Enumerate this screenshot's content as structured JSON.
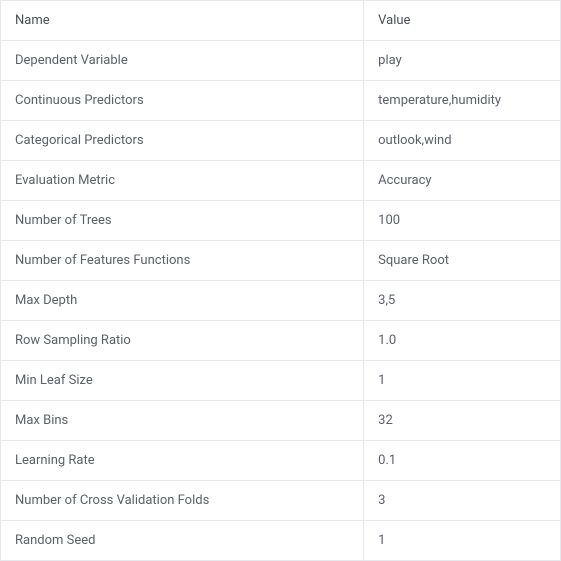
{
  "table": {
    "headers": {
      "name": "Name",
      "value": "Value"
    },
    "rows": [
      {
        "name": "Dependent Variable",
        "value": "play"
      },
      {
        "name": "Continuous Predictors",
        "value": "temperature,humidity"
      },
      {
        "name": "Categorical Predictors",
        "value": "outlook,wind"
      },
      {
        "name": "Evaluation Metric",
        "value": "Accuracy"
      },
      {
        "name": "Number of Trees",
        "value": "100"
      },
      {
        "name": "Number of Features Functions",
        "value": "Square Root"
      },
      {
        "name": "Max Depth",
        "value": "3,5"
      },
      {
        "name": "Row Sampling Ratio",
        "value": "1.0"
      },
      {
        "name": "Min Leaf Size",
        "value": "1"
      },
      {
        "name": "Max Bins",
        "value": "32"
      },
      {
        "name": "Learning Rate",
        "value": "0.1"
      },
      {
        "name": "Number of Cross Validation Folds",
        "value": "3"
      },
      {
        "name": "Random Seed",
        "value": "1"
      }
    ]
  }
}
